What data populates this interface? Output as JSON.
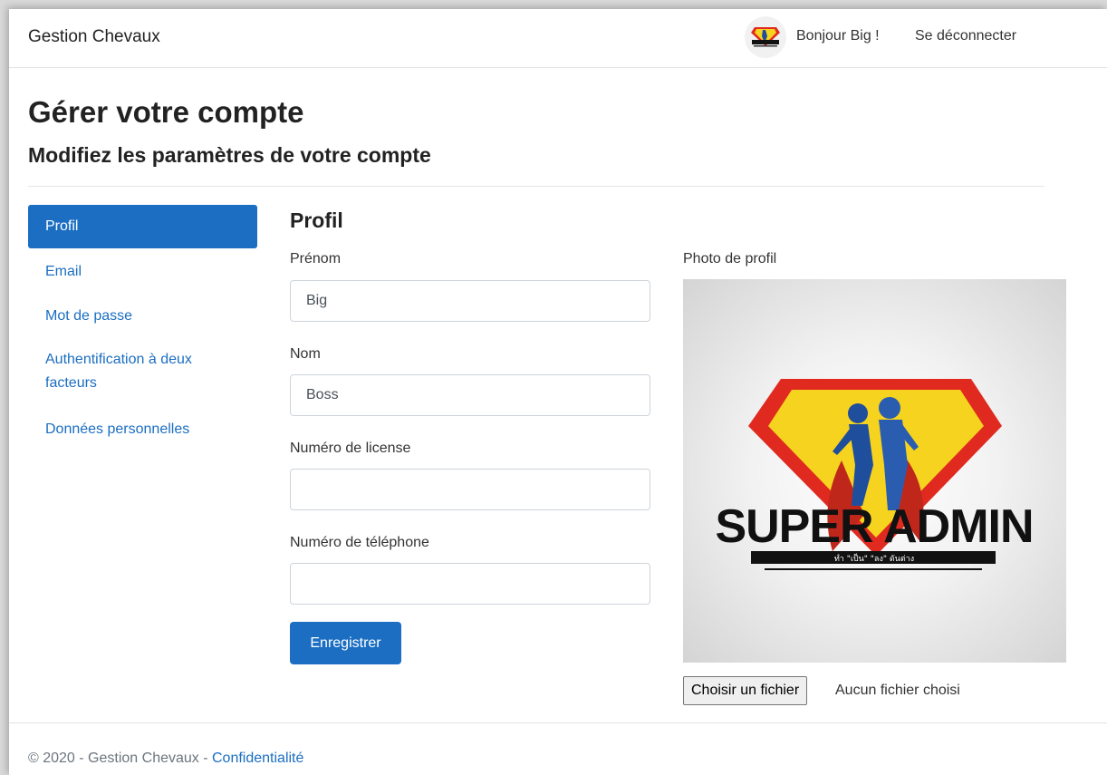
{
  "navbar": {
    "brand": "Gestion Chevaux",
    "greeting": "Bonjour Big !",
    "logout": "Se déconnecter"
  },
  "header": {
    "title": "Gérer votre compte",
    "subtitle": "Modifiez les paramètres de votre compte"
  },
  "sidebar": {
    "items": [
      {
        "label": "Profil",
        "active": true
      },
      {
        "label": "Email"
      },
      {
        "label": "Mot de passe"
      },
      {
        "label": "Authentification à deux facteurs"
      },
      {
        "label": "Données personnelles"
      }
    ]
  },
  "form": {
    "title": "Profil",
    "firstname_label": "Prénom",
    "firstname_value": "Big",
    "lastname_label": "Nom",
    "lastname_value": "Boss",
    "license_label": "Numéro de license",
    "license_value": "",
    "phone_label": "Numéro de téléphone",
    "phone_value": "",
    "save_label": "Enregistrer"
  },
  "photo": {
    "label": "Photo de profil",
    "logo_text": "SUPER ADMIN",
    "logo_subtext": "ทำ \"เป็น\" \"ลง\" ดันต่าง",
    "file_button": "Choisir un fichier",
    "file_status": "Aucun fichier choisi"
  },
  "footer": {
    "copyright": "© 2020 - Gestion Chevaux - ",
    "privacy_link": "Confidentialité"
  },
  "colors": {
    "primary": "#1b6ec2",
    "logo_red": "#e02a20",
    "logo_yellow": "#f6d31f",
    "logo_blue": "#1f4e9c"
  }
}
